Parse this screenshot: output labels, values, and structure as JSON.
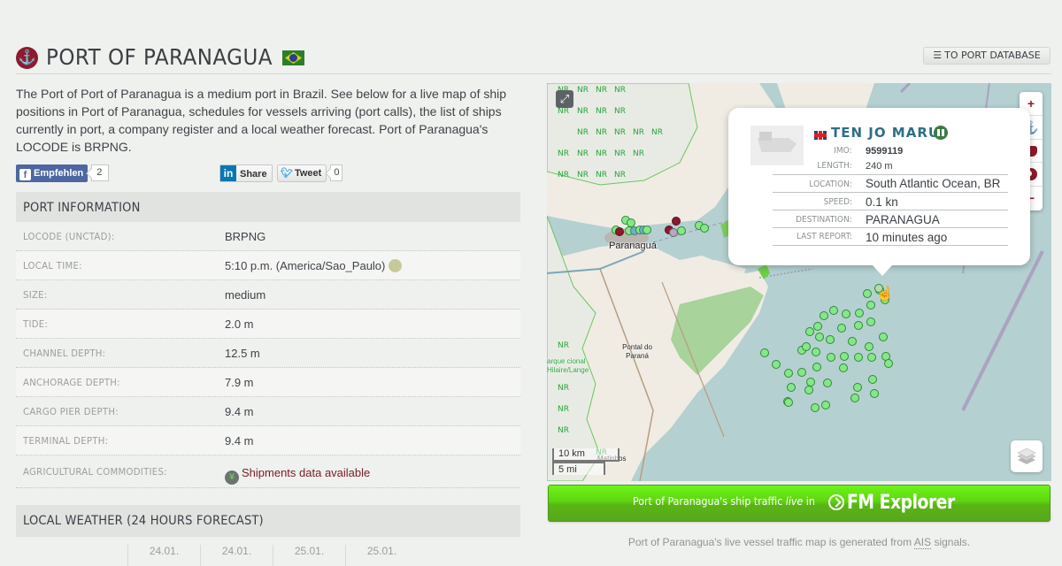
{
  "header": {
    "title": "PORT OF PARANAGUA",
    "database_button": "TO PORT DATABASE"
  },
  "intro": "The Port of Port of Paranagua is a medium port in Brazil. See below for a live map of ship positions in Port of Paranagua, schedules for vessels arriving (port calls), the list of ships currently in port, a company register and a local weather forecast. Port of Paranagua's LOCODE is BRPNG.",
  "social": {
    "facebook_label": "Empfehlen",
    "facebook_count": "2",
    "linkedin_label": "Share",
    "twitter_label": "Tweet",
    "twitter_count": "0"
  },
  "port_info": {
    "heading": "PORT INFORMATION",
    "rows": [
      {
        "label": "LOCODE (UNCTAD):",
        "value": "BRPNG"
      },
      {
        "label": "LOCAL TIME:",
        "value": "5:10 p.m. (America/Sao_Paulo)"
      },
      {
        "label": "SIZE:",
        "value": "medium"
      },
      {
        "label": "TIDE:",
        "value": "2.0 m"
      },
      {
        "label": "CHANNEL DEPTH:",
        "value": "12.5 m"
      },
      {
        "label": "ANCHORAGE DEPTH:",
        "value": "7.9 m"
      },
      {
        "label": "CARGO PIER DEPTH:",
        "value": "9.4 m"
      },
      {
        "label": "TERMINAL DEPTH:",
        "value": "9.4 m"
      },
      {
        "label": "AGRICULTURAL COMMODITIES:",
        "value": "Shipments data available"
      }
    ]
  },
  "weather": {
    "heading": "LOCAL WEATHER (24 HOURS FORECAST)",
    "columns": [
      {
        "date": "24.01."
      },
      {
        "date": "24.01."
      },
      {
        "date": "25.01."
      },
      {
        "date": "25.01."
      }
    ]
  },
  "map": {
    "places": [
      "Paranaguá",
      "Pontal do Paraná",
      "Matinhos",
      "arque cional Hilaire/Lange"
    ],
    "reserve_marker": "NR",
    "scale_km": "10 km",
    "scale_mi": "5 mi",
    "controls": [
      "zoom-in",
      "ports",
      "vessels",
      "world",
      "zoom-out"
    ],
    "popup": {
      "ship_name": "TEN JO MARU",
      "imo_label": "IMO:",
      "imo": "9599119",
      "length_label": "LENGTH:",
      "length": "240 m",
      "location_label": "LOCATION:",
      "location": "South Atlantic Ocean, BR",
      "speed_label": "SPEED:",
      "speed": "0.1 kn",
      "destination_label": "DESTINATION:",
      "destination": "PARANAGUA",
      "last_report_label": "LAST REPORT:",
      "last_report": "10 minutes ago"
    }
  },
  "banner": {
    "lead": "Port of Paranagua's ship traffic",
    "live": "live",
    "in": "in",
    "brand": "FM Explorer"
  },
  "ais_note": {
    "before": "Port of Paranagua's live vessel traffic map is generated from",
    "ais": "AIS",
    "after": "signals."
  },
  "colors": {
    "brand_red": "#8c1b2e",
    "banner_green": "#5ed411",
    "vessel_green": "#86e78a",
    "ship_name_blue": "#2e6f85"
  }
}
